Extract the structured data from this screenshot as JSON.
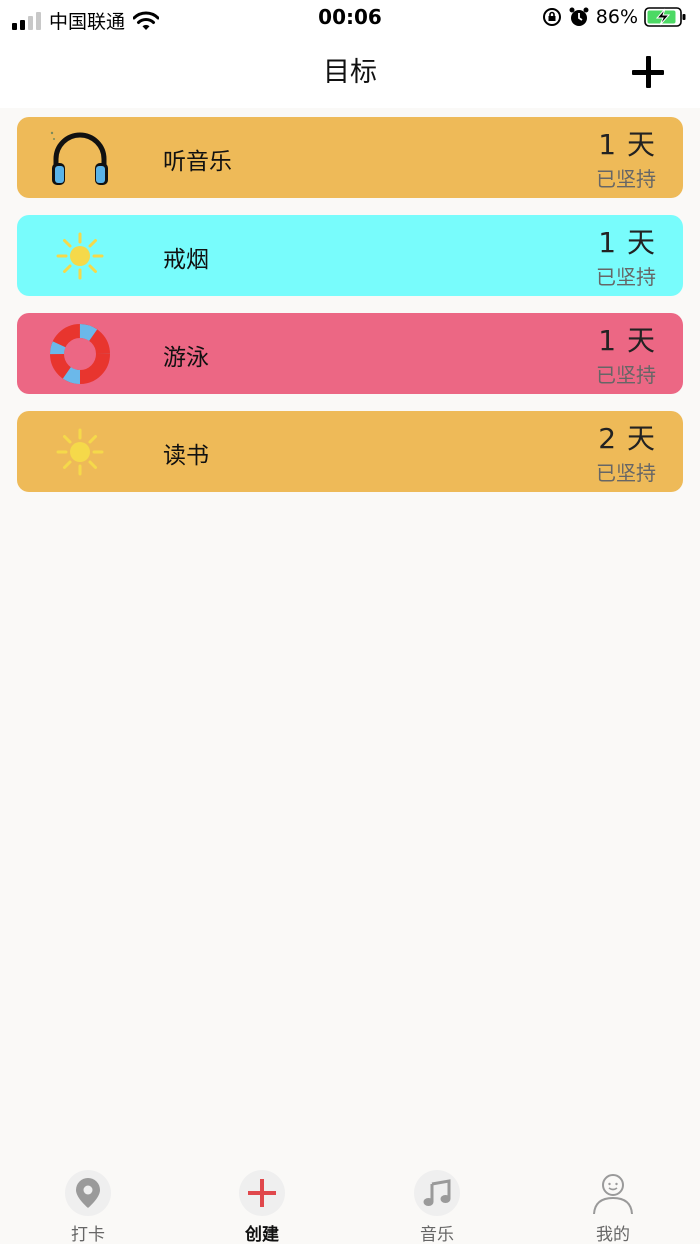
{
  "status_bar": {
    "carrier": "中国联通",
    "time": "00:06",
    "battery_percent": "86%"
  },
  "nav": {
    "title": "目标"
  },
  "goals": [
    {
      "name": "听音乐",
      "days": "1 天",
      "subtitle": "已坚持",
      "color": "#eeba58",
      "icon": "headphones-icon"
    },
    {
      "name": "戒烟",
      "days": "1 天",
      "subtitle": "已坚持",
      "color": "#78fcfc",
      "icon": "sun-icon"
    },
    {
      "name": "游泳",
      "days": "1 天",
      "subtitle": "已坚持",
      "color": "#ec6784",
      "icon": "life-ring-icon"
    },
    {
      "name": "读书",
      "days": "2 天",
      "subtitle": "已坚持",
      "color": "#eeba58",
      "icon": "sun-icon"
    }
  ],
  "tabs": [
    {
      "label": "打卡",
      "icon": "location-pin-icon",
      "active": false
    },
    {
      "label": "创建",
      "icon": "plus-icon",
      "active": true
    },
    {
      "label": "音乐",
      "icon": "music-note-icon",
      "active": false
    },
    {
      "label": "我的",
      "icon": "person-icon",
      "active": false
    }
  ]
}
